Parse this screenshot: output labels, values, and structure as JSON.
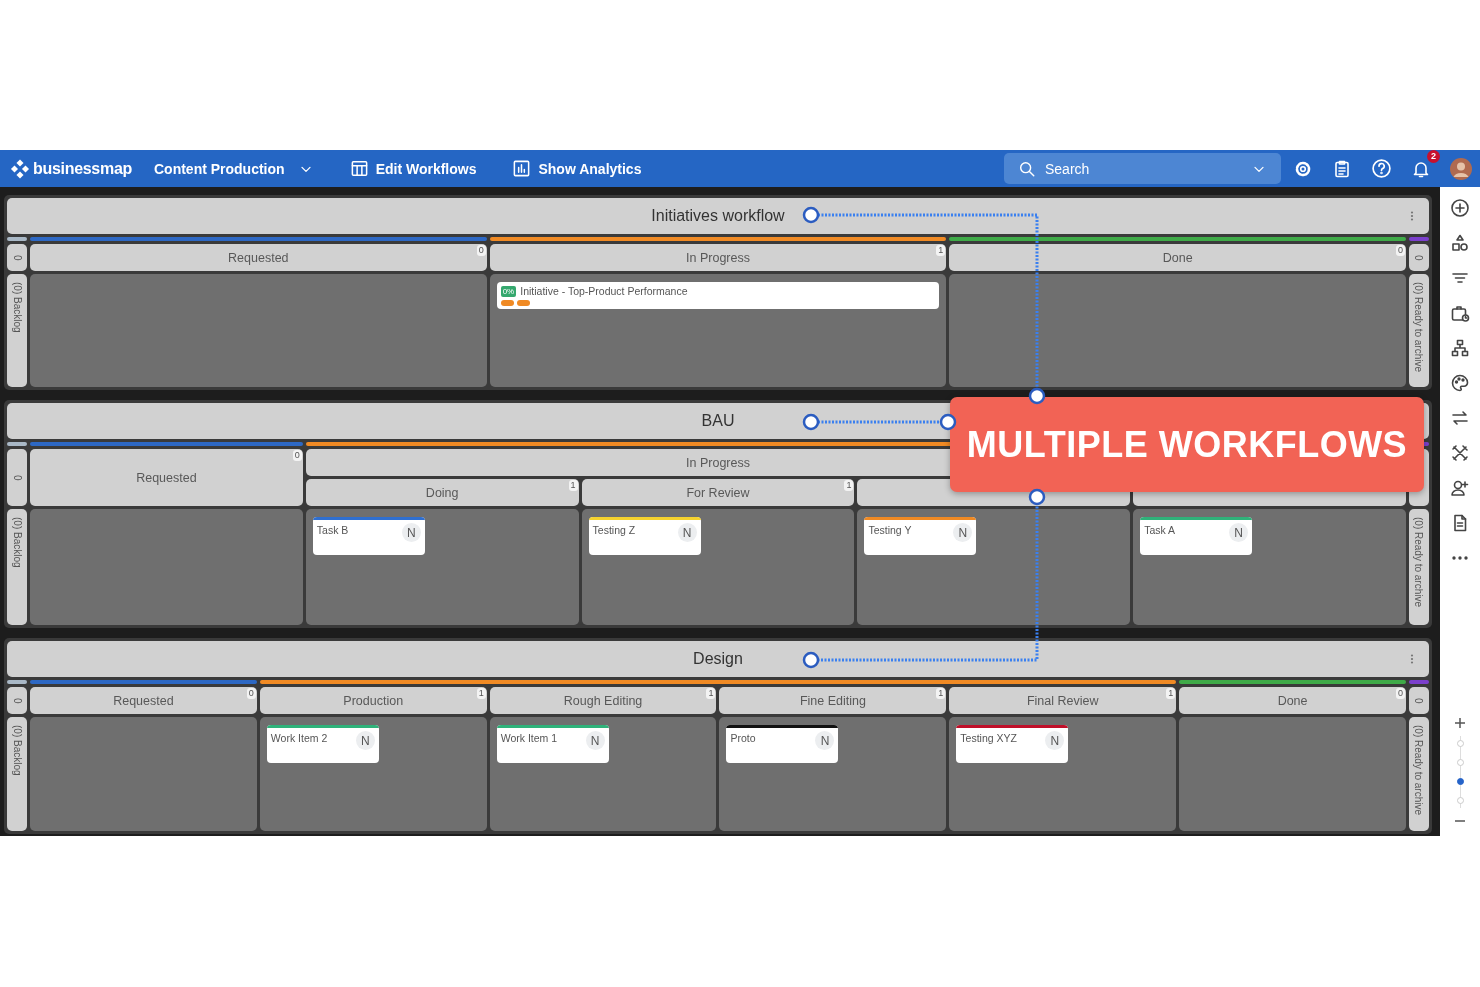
{
  "topbar": {
    "logo": "businessmap",
    "board_selector": "Content Production",
    "actions": [
      {
        "kind": "edit",
        "label": "Edit Workflows"
      },
      {
        "kind": "analytics",
        "label": "Show Analytics"
      }
    ],
    "search": {
      "placeholder": "Search"
    },
    "notifications": {
      "count": "2"
    }
  },
  "workflows": [
    {
      "title": "Initiatives workflow",
      "menu": true,
      "left_lane": {
        "count": "0",
        "label": "(0) Backlog"
      },
      "right_lane": {
        "count": "0",
        "label": "(0) Ready to archive"
      },
      "stages": [
        {
          "color": "#2d68c4",
          "columns": [
            {
              "label": "Requested",
              "count": "0"
            }
          ]
        },
        {
          "color": "#f08a24",
          "columns": [
            {
              "label": "In Progress",
              "count": "1",
              "cards": [
                {
                  "kind": "initiative",
                  "title": "Initiative - Top-Product Performance",
                  "progress": "0%",
                  "tags": [
                    {
                      "color": "#f08a24"
                    },
                    {
                      "color": "#f08a24"
                    }
                  ]
                }
              ]
            }
          ]
        },
        {
          "color": "#3faa48",
          "columns": [
            {
              "label": "Done",
              "count": "0"
            }
          ]
        }
      ]
    },
    {
      "title": "BAU",
      "menu": false,
      "left_lane": {
        "count": "0",
        "label": "(0) Backlog"
      },
      "right_lane": {
        "label": "(0) Ready to archive"
      },
      "stages": [
        {
          "color": "#2d68c4",
          "columns": [
            {
              "label": "Requested",
              "count": "0"
            }
          ]
        },
        {
          "color": "#f08a24",
          "group_label": "In Progress",
          "columns": [
            {
              "label": "Doing",
              "count": "1",
              "cards": [
                {
                  "kind": "task",
                  "title": "Task B",
                  "color": "#2f6fd0",
                  "avatar": "N"
                }
              ]
            },
            {
              "label": "For Review",
              "count": "1",
              "cards": [
                {
                  "kind": "task",
                  "title": "Testing Z",
                  "color": "#f5d22e",
                  "avatar": "N"
                }
              ]
            },
            {
              "cards": [
                {
                  "kind": "task",
                  "title": "Testing Y",
                  "color": "#f08a24",
                  "avatar": "N"
                }
              ]
            }
          ]
        },
        {
          "columns": [
            {
              "cards": [
                {
                  "kind": "task",
                  "title": "Task A",
                  "color": "#2fb27a",
                  "avatar": "N"
                }
              ]
            }
          ]
        }
      ]
    },
    {
      "title": "Design",
      "menu": true,
      "left_lane": {
        "count": "0",
        "label": "(0) Backlog"
      },
      "right_lane": {
        "count": "0",
        "label": "(0) Ready to archive"
      },
      "stages": [
        {
          "color": "#2d68c4",
          "columns": [
            {
              "label": "Requested",
              "count": "0"
            }
          ]
        },
        {
          "color": "#f08a24",
          "columns": [
            {
              "label": "Production",
              "count": "1",
              "cards": [
                {
                  "kind": "task",
                  "title": "Work Item 2",
                  "color": "#2fb27a",
                  "avatar": "N"
                }
              ]
            },
            {
              "label": "Rough Editing",
              "count": "1",
              "cards": [
                {
                  "kind": "task",
                  "title": "Work Item 1",
                  "color": "#2fb27a",
                  "avatar": "N"
                }
              ]
            },
            {
              "label": "Fine Editing",
              "count": "1",
              "cards": [
                {
                  "kind": "task",
                  "title": "Proto",
                  "color": "#111111",
                  "avatar": "N"
                }
              ]
            },
            {
              "label": "Final Review",
              "count": "1",
              "cards": [
                {
                  "kind": "task",
                  "title": "Testing XYZ",
                  "color": "#c0102a",
                  "avatar": "N"
                }
              ]
            }
          ]
        },
        {
          "color": "#3faa48",
          "columns": [
            {
              "label": "Done",
              "count": "0"
            }
          ]
        }
      ]
    }
  ],
  "callout": {
    "text": "MULTIPLE WORKFLOWS"
  },
  "sidebar": {
    "zoom_stops": [
      {
        "selected": false
      },
      {
        "selected": false
      },
      {
        "selected": true
      },
      {
        "selected": false
      }
    ]
  }
}
